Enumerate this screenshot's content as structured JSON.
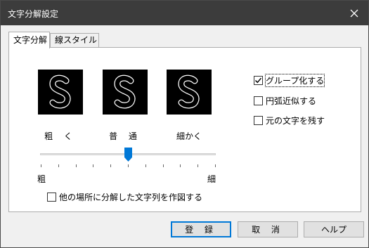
{
  "window": {
    "title": "文字分解設定"
  },
  "tabs": [
    {
      "label": "文字分解",
      "active": true
    },
    {
      "label": "線スタイル",
      "active": false
    }
  ],
  "previews": [
    {
      "glyph": "S",
      "label": "粗 く"
    },
    {
      "glyph": "S",
      "label": "普 通"
    },
    {
      "glyph": "S",
      "label": "細かく"
    }
  ],
  "slider": {
    "min_label": "粗",
    "max_label": "細",
    "value_fraction": 0.5,
    "tick_count": 11
  },
  "options": [
    {
      "label": "グループ化する",
      "checked": true
    },
    {
      "label": "円弧近似する",
      "checked": false
    },
    {
      "label": "元の文字を残す",
      "checked": false
    }
  ],
  "other_place": {
    "label": "他の場所に分解した文字列を作図する",
    "checked": false
  },
  "buttons": {
    "register": "登 録",
    "cancel": "取 消",
    "help": "ヘルプ"
  },
  "icons": {
    "close": "close-icon",
    "check": "check-icon"
  }
}
